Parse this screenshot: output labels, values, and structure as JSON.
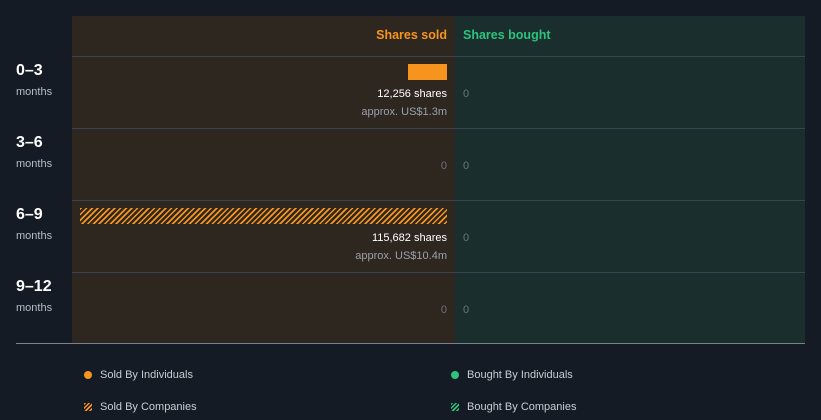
{
  "chart_data": {
    "type": "bar",
    "orientation": "horizontal",
    "columns": [
      "Shares sold",
      "Shares bought"
    ],
    "categories": [
      {
        "range": "0–3",
        "unit": "months"
      },
      {
        "range": "3–6",
        "unit": "months"
      },
      {
        "range": "6–9",
        "unit": "months"
      },
      {
        "range": "9–12",
        "unit": "months"
      }
    ],
    "series": [
      {
        "name": "Sold By Individuals",
        "values": [
          12256,
          0,
          0,
          0
        ],
        "color": "#f7941d"
      },
      {
        "name": "Sold By Companies",
        "values": [
          0,
          0,
          115682,
          0
        ],
        "color": "#f7941d"
      },
      {
        "name": "Bought By Individuals",
        "values": [
          0,
          0,
          0,
          0
        ],
        "color": "#2ec27e"
      },
      {
        "name": "Bought By Companies",
        "values": [
          0,
          0,
          0,
          0
        ],
        "color": "#2ec27e"
      }
    ],
    "sold_labels": [
      {
        "shares": "12,256 shares",
        "approx": "approx. US$1.3m"
      },
      {
        "shares": "0",
        "approx": ""
      },
      {
        "shares": "115,682 shares",
        "approx": "approx. US$10.4m"
      },
      {
        "shares": "0",
        "approx": ""
      }
    ],
    "bought_labels": [
      "0",
      "0",
      "0",
      "0"
    ],
    "xlim": [
      0,
      115682
    ],
    "legend": "bottom",
    "colors": {
      "sold": "#f7941d",
      "bought": "#2ec27e"
    }
  }
}
